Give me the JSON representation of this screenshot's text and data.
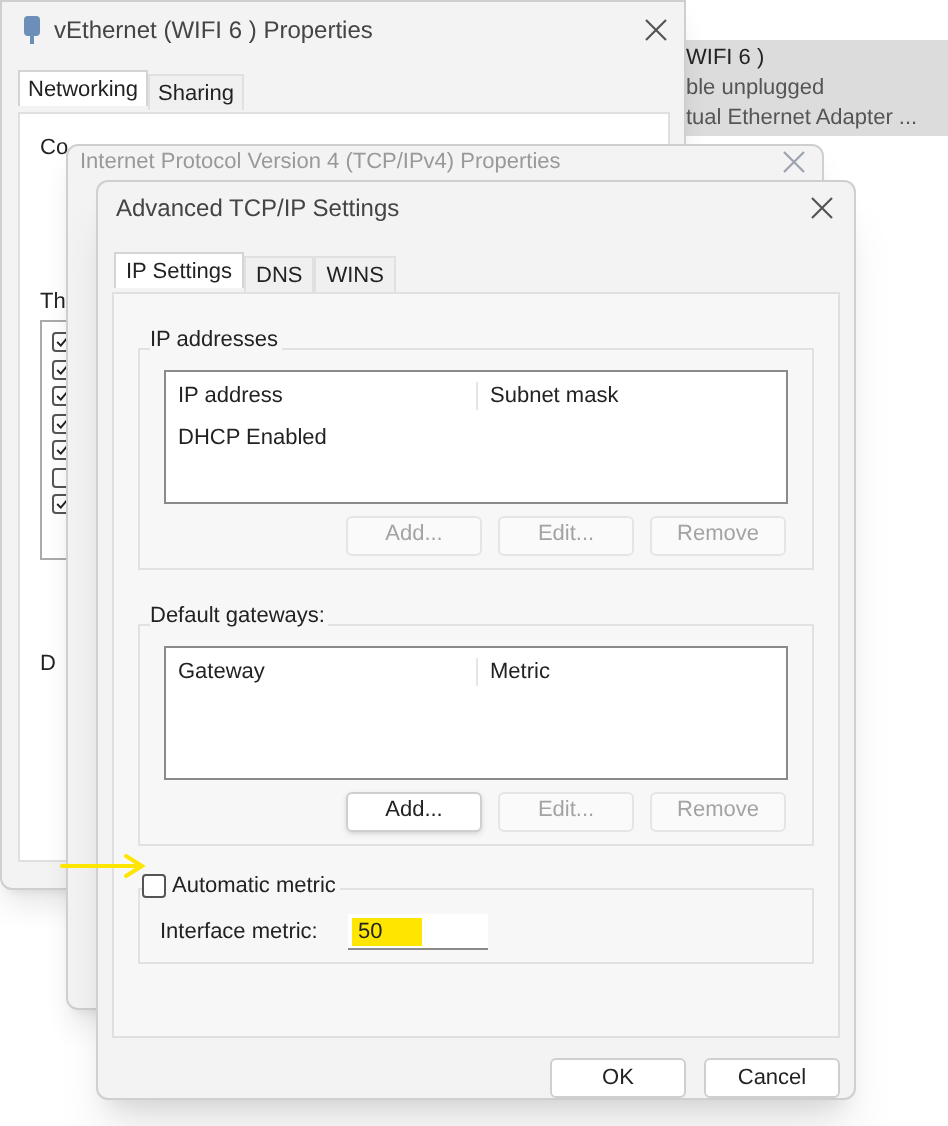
{
  "background_panel": {
    "lines": [
      "WIFI 6 )",
      "ble unplugged",
      "tual Ethernet Adapter ..."
    ]
  },
  "properties_window": {
    "title": "vEthernet (WIFI 6 ) Properties",
    "tabs": [
      {
        "label": "Networking",
        "selected": true
      },
      {
        "label": "Sharing",
        "selected": false
      }
    ],
    "connect_label": "Co",
    "items_label": "Th",
    "description_label": "D",
    "items": [
      {
        "checked": true
      },
      {
        "checked": true
      },
      {
        "checked": true
      },
      {
        "checked": true
      },
      {
        "checked": true
      },
      {
        "checked": false
      },
      {
        "checked": true
      }
    ]
  },
  "ipv4_window": {
    "title": "Internet Protocol Version 4 (TCP/IPv4) Properties"
  },
  "advanced_window": {
    "title": "Advanced TCP/IP Settings",
    "tabs": [
      {
        "label": "IP Settings",
        "selected": true
      },
      {
        "label": "DNS",
        "selected": false
      },
      {
        "label": "WINS",
        "selected": false
      }
    ],
    "groups": [
      {
        "title": "IP addresses",
        "columns": [
          "IP address",
          "Subnet mask"
        ],
        "rows": [
          "DHCP Enabled"
        ],
        "buttons": [
          {
            "label": "Add...",
            "disabled": true
          },
          {
            "label": "Edit...",
            "disabled": true
          },
          {
            "label": "Remove",
            "disabled": true
          }
        ]
      },
      {
        "title": "Default gateways:",
        "columns": [
          "Gateway",
          "Metric"
        ],
        "buttons": [
          {
            "label": "Add...",
            "disabled": false
          },
          {
            "label": "Edit...",
            "disabled": true
          },
          {
            "label": "Remove",
            "disabled": true
          }
        ]
      }
    ],
    "automatic_metric": {
      "label": "Automatic metric",
      "checked": false
    },
    "interface_metric": {
      "label": "Interface metric:",
      "value": "50",
      "highlighted": true
    },
    "buttons": [
      "OK",
      "Cancel"
    ]
  }
}
